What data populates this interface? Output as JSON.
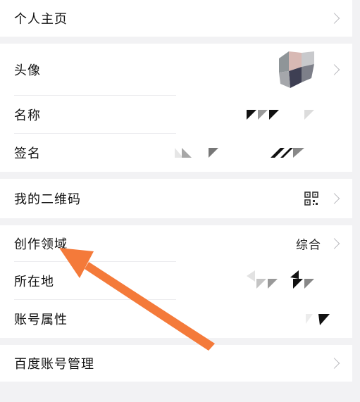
{
  "rows": {
    "profile": {
      "label": "个人主页"
    },
    "avatar": {
      "label": "头像"
    },
    "name": {
      "label": "名称"
    },
    "signature": {
      "label": "签名"
    },
    "qrcode": {
      "label": "我的二维码"
    },
    "field": {
      "label": "创作领域",
      "value": "综合"
    },
    "location": {
      "label": "所在地"
    },
    "account_attr": {
      "label": "账号属性"
    },
    "baidu_account": {
      "label": "百度账号管理"
    }
  },
  "icons": {
    "chevron": "chevron-right-icon",
    "qr": "qr-code-icon",
    "arrow": "arrow-annotation-icon"
  },
  "colors": {
    "background": "#f2f2f4",
    "card": "#ffffff",
    "chevron": "#b9b9be",
    "annotation_arrow": "#f47a3a"
  }
}
